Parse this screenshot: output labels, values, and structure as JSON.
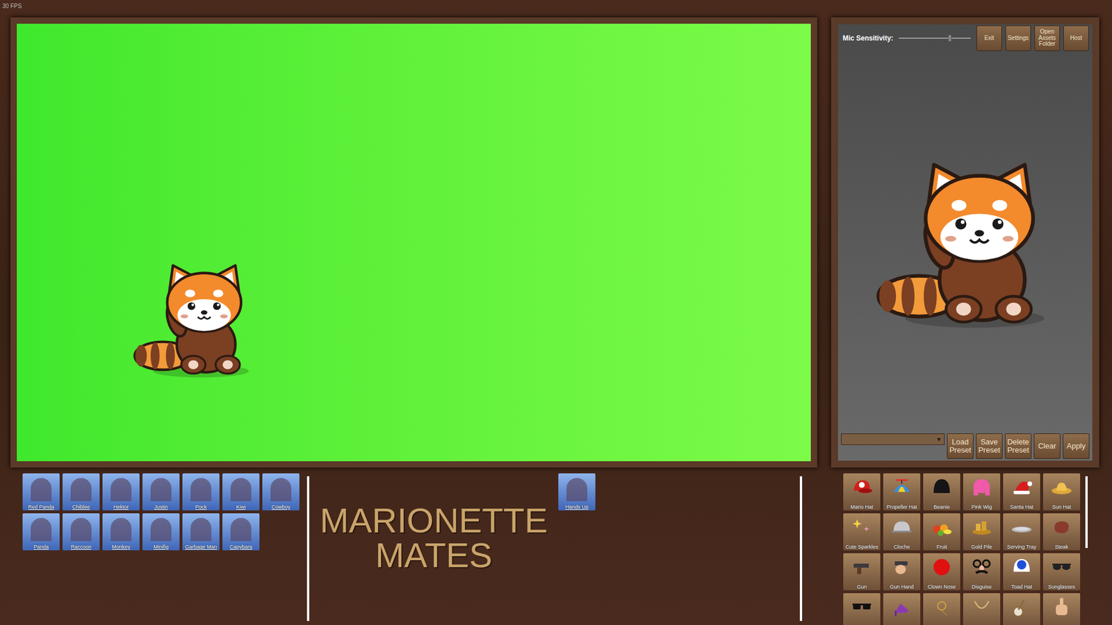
{
  "status": {
    "fps": "30 FPS"
  },
  "controls": {
    "mic_label": "Mic Sensitivity:",
    "mic_level": 0.71,
    "buttons": [
      "Exit",
      "Settings",
      "Open Assets Folder",
      "Host"
    ]
  },
  "preset": {
    "arrow": "▾",
    "buttons": [
      "Load Preset",
      "Save Preset",
      "Delete Preset",
      "Clear",
      "Apply"
    ]
  },
  "characters": [
    {
      "name": "Red Panda"
    },
    {
      "name": "Chiblee"
    },
    {
      "name": "Hektor"
    },
    {
      "name": "Justin"
    },
    {
      "name": "Pock"
    },
    {
      "name": "Kiwi"
    },
    {
      "name": "Cowboy"
    },
    {
      "name": "Panda"
    },
    {
      "name": "Raccoon"
    },
    {
      "name": "Monkey"
    },
    {
      "name": "Minifig"
    },
    {
      "name": "Garbage Man"
    },
    {
      "name": "Capybara"
    }
  ],
  "logo": {
    "lines": [
      "MARIONETTE",
      "MATES"
    ]
  },
  "poses": [
    {
      "name": "Hands Up"
    }
  ],
  "accessories": [
    {
      "name": "Mario Hat",
      "kind": "mario_hat"
    },
    {
      "name": "Propeller Hat",
      "kind": "propeller_hat"
    },
    {
      "name": "Beanie",
      "kind": "beanie"
    },
    {
      "name": "Pink Wig",
      "kind": "pink_wig"
    },
    {
      "name": "Santa Hat",
      "kind": "santa_hat"
    },
    {
      "name": "Sun Hat",
      "kind": "sun_hat"
    },
    {
      "name": "Cute Sparkles",
      "kind": "sparkles"
    },
    {
      "name": "Cloche",
      "kind": "cloche"
    },
    {
      "name": "Fruit",
      "kind": "fruit"
    },
    {
      "name": "Gold Pile",
      "kind": "gold_pile"
    },
    {
      "name": "Serving Tray",
      "kind": "tray"
    },
    {
      "name": "Steak",
      "kind": "steak"
    },
    {
      "name": "Gun",
      "kind": "gun"
    },
    {
      "name": "Gun Hand",
      "kind": "gun_hand"
    },
    {
      "name": "Clown Nose",
      "kind": "clown_nose"
    },
    {
      "name": "Disguise",
      "kind": "disguise"
    },
    {
      "name": "Toad Hat",
      "kind": "toad_hat"
    },
    {
      "name": "Sunglasses",
      "kind": "sunglasses"
    },
    {
      "kind": "shades"
    },
    {
      "kind": "heels"
    },
    {
      "kind": "monocle"
    },
    {
      "kind": "necklace"
    },
    {
      "kind": "banjo"
    },
    {
      "kind": "hand"
    }
  ]
}
